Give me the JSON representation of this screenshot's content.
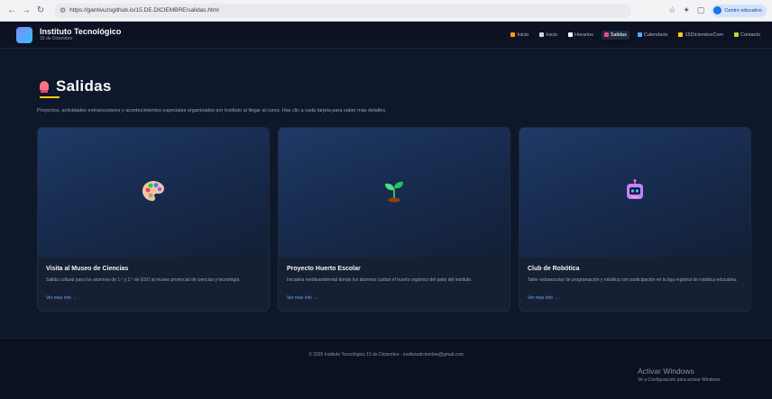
{
  "browser": {
    "url": "https://gantivuzsgithub.io/15.DE.DICIEMBRE/salidas.html",
    "profile_label": "Centro educativo"
  },
  "header": {
    "title": "Instituto Tecnológico",
    "subtitle": "15 de Diciembre",
    "nav": [
      {
        "label": "Inicio",
        "color": "#f59e0b"
      },
      {
        "label": "Inicio",
        "color": "#cbd5e1"
      },
      {
        "label": "Horarios",
        "color": "#f8fafc"
      },
      {
        "label": "Salidas",
        "color": "#ec4899"
      },
      {
        "label": "Calendario",
        "color": "#60a5fa"
      },
      {
        "label": "15DiciembreCom",
        "color": "#facc15"
      },
      {
        "label": "Contacto",
        "color": "#a3e635"
      }
    ],
    "active_index": 3
  },
  "page": {
    "title": "Salidas",
    "description": "Proyectos, actividades extraescolares y acontecimientos especiales organizados por Instituto al llegar al curso. Has clic a cada tarjeta para saber más detalles."
  },
  "cards": [
    {
      "icon": "palette-icon",
      "title": "Visita al Museo de Ciencias",
      "text": "Salida cultural para los alumnos de 1.º y 2.º de ESO al museo provincial de ciencias y tecnología.",
      "link": "Ver más info →"
    },
    {
      "icon": "seedling-icon",
      "title": "Proyecto Huerto Escolar",
      "text": "Iniciativa medioambiental donde los alumnos cuidan el huerto orgánico del patio del instituto.",
      "link": "Ver más info →"
    },
    {
      "icon": "robot-icon",
      "title": "Club de Robótica",
      "text": "Taller extraescolar de programación y robótica con participación en la liga regional de robótica educativa.",
      "link": "Ver más info →"
    }
  ],
  "footer": {
    "text": "© 2025 Instituto Tecnológico 15 de Diciembre · institutodiciembre@gmail.com"
  },
  "watermark": {
    "title": "Activar Windows",
    "subtitle": "Ve a Configuración para activar Windows."
  }
}
